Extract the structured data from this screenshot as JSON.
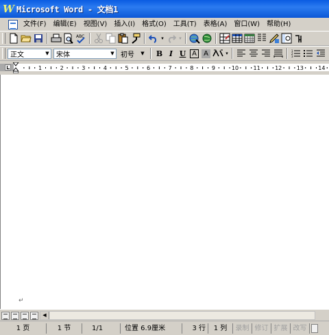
{
  "window": {
    "title": "Microsoft Word - 文档1"
  },
  "menu": {
    "items": [
      {
        "label": "文件(F)"
      },
      {
        "label": "编辑(E)"
      },
      {
        "label": "视图(V)"
      },
      {
        "label": "插入(I)"
      },
      {
        "label": "格式(O)"
      },
      {
        "label": "工具(T)"
      },
      {
        "label": "表格(A)"
      },
      {
        "label": "窗口(W)"
      },
      {
        "label": "帮助(H)"
      }
    ]
  },
  "format_toolbar": {
    "style_value": "正文",
    "font_value": "宋体",
    "size_value": "初号",
    "bold_label": "B",
    "italic_label": "I",
    "underline_label": "U",
    "border_label": "A",
    "shading_label": "A"
  },
  "ruler": {
    "numbers": [
      "1",
      "2",
      "3",
      "4",
      "5",
      "6",
      "7",
      "8",
      "9",
      "10",
      "11",
      "12",
      "13",
      "14"
    ]
  },
  "document": {
    "paragraph_mark": "↵"
  },
  "status": {
    "page": "1 页",
    "section": "1 节",
    "page_of": "1/1",
    "position": "位置 6.9厘米",
    "line": "3 行",
    "column": "1 列",
    "rec": "录制",
    "trk": "修订",
    "ext": "扩展",
    "ovr": "改写"
  },
  "colors": {
    "titlebar": "#0a5ce2",
    "chrome": "#d4d0c8",
    "page": "#ffffff"
  }
}
